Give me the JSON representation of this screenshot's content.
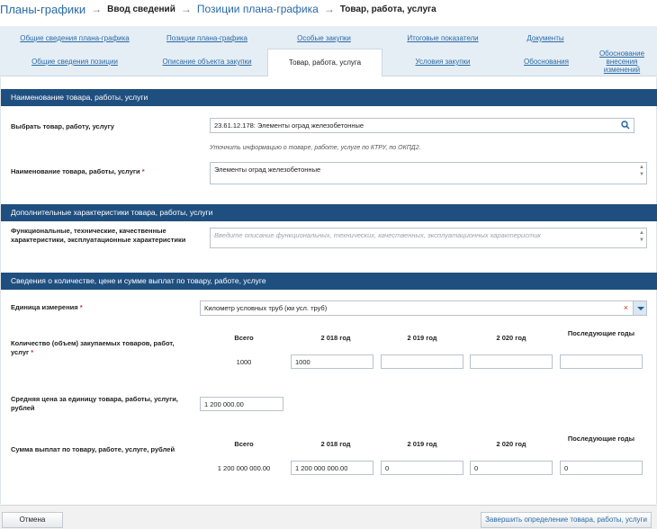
{
  "breadcrumb": {
    "root": "Планы-графики",
    "step1": "Ввод сведений",
    "step2": "Позиции плана-графика",
    "current": "Товар, работа, услуга"
  },
  "tabs_row1": [
    "Общие сведения плана-графика",
    "Позиции плана-графика",
    "Особые закупки",
    "Итоговые показатели",
    "Документы"
  ],
  "tabs_row2": [
    "Общие сведения позиции",
    "Описание объекта закупки",
    "Товар, работа, услуга",
    "Условия закупки",
    "Обоснования",
    "Обоснование внесения изменений"
  ],
  "section1": {
    "title": "Наименование товара, работы, услуги",
    "choose_label": "Выбрать товар, работу, услугу",
    "choose_value": "23.61.12.178: Элементы оград железобетонные",
    "hint": "Уточнить информацию о товаре, работе, услуге по КТРУ, по ОКПД2.",
    "name_label": "Наименование товара, работы, услуги",
    "required_mark": "*",
    "name_value": "Элементы оград железобетонные"
  },
  "section2": {
    "title": "Дополнительные характеристики товара, работы, услуги",
    "label": "Функциональные, технические, качественные характеристики, эксплуатационные характеристики",
    "placeholder": "Введите описание функциональных, технических, качественных, эксплуатационных характеристик"
  },
  "section3": {
    "title": "Сведения о количестве, цене и сумме выплат по товару, работе, услуге",
    "unit_label": "Единица измерения",
    "unit_value": "Километр условных труб (км усл. труб)",
    "clear_symbol": "×",
    "qty_label": "Количество (объем) закупаемых товаров, работ, услуг",
    "headers": [
      "Всего",
      "2 018 год",
      "2 019 год",
      "2 020 год",
      "Последующие годы"
    ],
    "qty_total": "1000",
    "qty_values": [
      "1000",
      "",
      "",
      ""
    ],
    "price_label": "Средняя цена за единицу товара, работы, услуги, рублей",
    "price_value": "1 200 000.00",
    "sum_label": "Сумма выплат по товару, работе, услуге, рублей",
    "sum_headers": [
      "Всего",
      "2 018 год",
      "2 019 год",
      "2 020 год",
      "Последующие годы"
    ],
    "sum_total": "1 200 000 000.00",
    "sum_values": [
      "1 200 000 000.00",
      "0",
      "0",
      "0"
    ]
  },
  "footer": {
    "cancel": "Отмена",
    "finish": "Завершить определение товара, работы, услуги"
  },
  "colors": {
    "section_header": "#1f4f7f",
    "link": "#2a6aa6",
    "tab_bg": "#e6eef5",
    "required": "#c0392b"
  }
}
